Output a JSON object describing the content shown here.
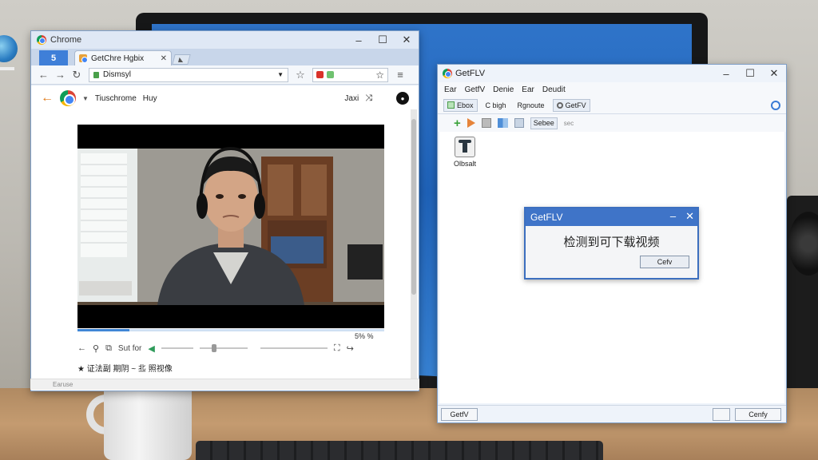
{
  "chrome": {
    "title": "Chrome",
    "tab_count": "5",
    "tab_title": "GetChre Hgbix",
    "address": "Dismsyl",
    "page": {
      "brand": "Tiuschrome",
      "brand_link": "Huy",
      "right_text": "Jaxi",
      "video_progress": 0.17,
      "volume_level": 0.25,
      "time_text": "5% %",
      "control_label": "Sut for",
      "caption": "★ 证法副 期阴 ~ 丠 照视像"
    },
    "status_items": [
      "",
      "",
      "Earuse"
    ]
  },
  "getflv": {
    "title": "GetFLV",
    "menu": [
      "Ear",
      "GetfV",
      "Denie",
      "Ear",
      "Deudit"
    ],
    "tabs": [
      "Ebox",
      "C bigh",
      "Rgnoute",
      "GetFV"
    ],
    "toolbar_select": "Sebee",
    "toolbar_ext": "sec",
    "file_item": "Olbsalt",
    "status_left": "GetfV",
    "status_right": "Cenfy"
  },
  "dialog": {
    "title": "GetFLV",
    "message": "检测到可下载视频",
    "ok_label": "Cefv"
  }
}
